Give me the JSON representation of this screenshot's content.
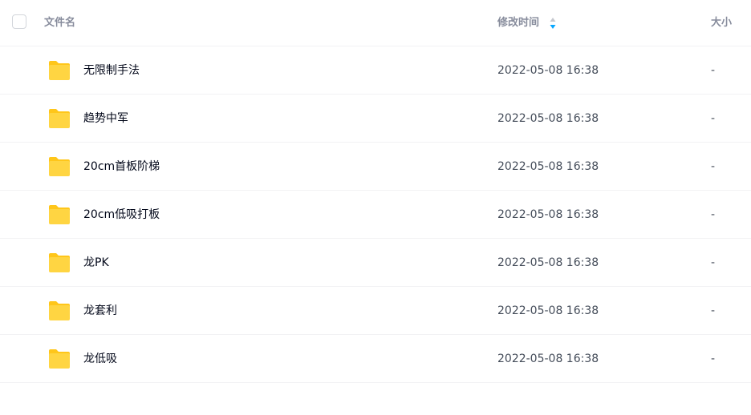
{
  "header": {
    "name_label": "文件名",
    "time_label": "修改时间",
    "size_label": "大小"
  },
  "colors": {
    "folder": "#ffd542",
    "folder_tab": "#ffc61a",
    "sort_active": "#06a7ff"
  },
  "icons": {
    "folder": "folder-icon",
    "sort": "sort-icon",
    "checkbox": "checkbox"
  },
  "files": [
    {
      "name": "无限制手法",
      "modified": "2022-05-08 16:38",
      "size": "-"
    },
    {
      "name": "趋势中军",
      "modified": "2022-05-08 16:38",
      "size": "-"
    },
    {
      "name": "20cm首板阶梯",
      "modified": "2022-05-08 16:38",
      "size": "-"
    },
    {
      "name": "20cm低吸打板",
      "modified": "2022-05-08 16:38",
      "size": "-"
    },
    {
      "name": "龙PK",
      "modified": "2022-05-08 16:38",
      "size": "-"
    },
    {
      "name": "龙套利",
      "modified": "2022-05-08 16:38",
      "size": "-"
    },
    {
      "name": "龙低吸",
      "modified": "2022-05-08 16:38",
      "size": "-"
    }
  ]
}
